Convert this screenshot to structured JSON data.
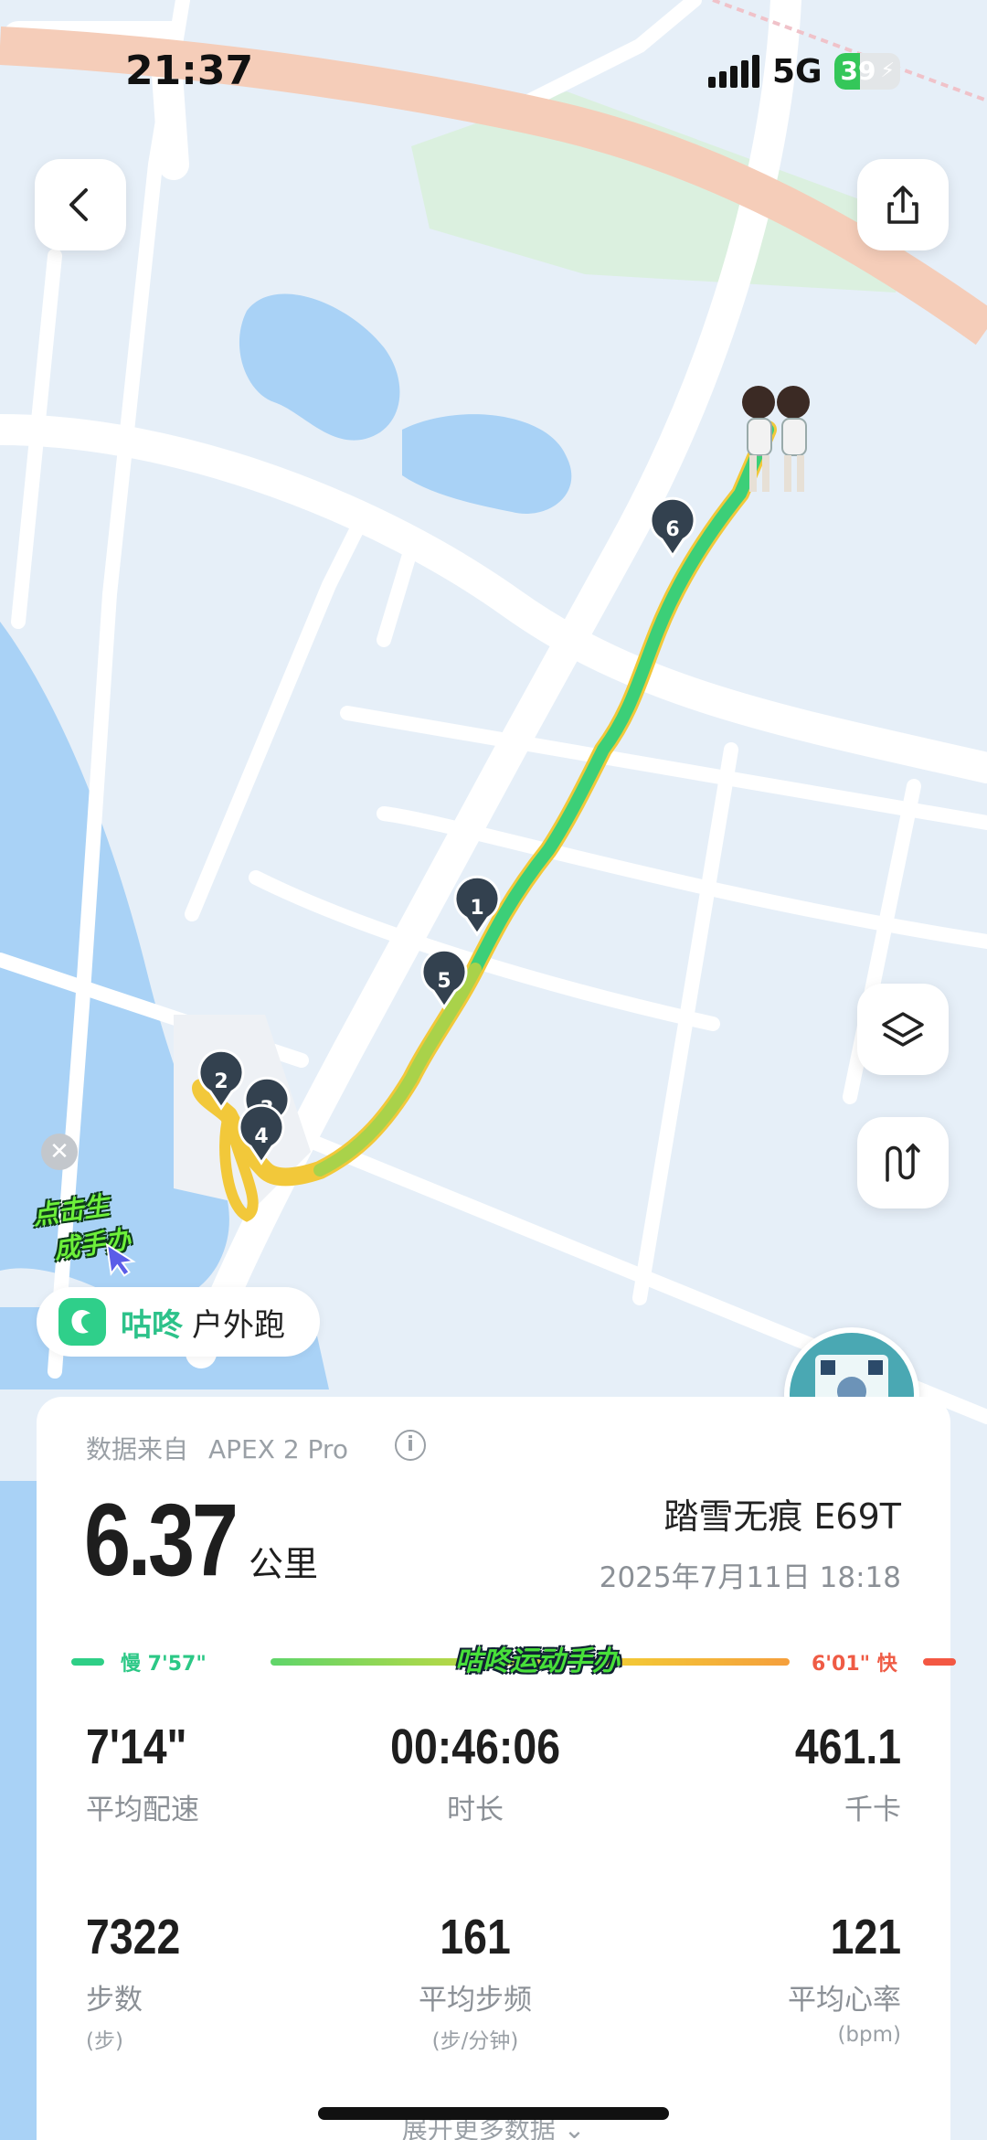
{
  "status_bar": {
    "time": "21:37",
    "network": "5G",
    "battery_level": "39",
    "battery_fraction": 0.39
  },
  "map": {
    "km_markers": [
      "1",
      "2",
      "3",
      "4",
      "5",
      "6"
    ],
    "route_colors": {
      "fast": "#2ecf7e",
      "mid": "#a9d24a",
      "slow": "#f2c83a"
    }
  },
  "sticker": {
    "line1": "点击生",
    "line2": "成手办"
  },
  "sport_pill": {
    "brand": "咕咚",
    "sport": "户外跑"
  },
  "card": {
    "source_label": "数据来自",
    "source_device": "APEX 2 Pro",
    "distance": "6.37",
    "distance_unit": "公里",
    "shoe": "踏雪无痕 E69T",
    "datetime": "2025年7月11日 18:18",
    "pace_range": {
      "slow_label": "慢 7'57\"",
      "fast_label": "6'01\" 快",
      "sticker_text": "咕咚运动手办"
    },
    "stats": [
      {
        "value": "7'14\"",
        "label": "平均配速",
        "sub": ""
      },
      {
        "value": "00:46:06",
        "label": "时长",
        "sub": ""
      },
      {
        "value": "461.1",
        "label": "千卡",
        "sub": ""
      },
      {
        "value": "7322",
        "label": "步数",
        "sub": "(步)"
      },
      {
        "value": "161",
        "label": "平均步频",
        "sub": "(步/分钟)"
      },
      {
        "value": "121",
        "label": "平均心率",
        "sub": "(bpm)"
      }
    ],
    "expand_label": "展开更多数据"
  },
  "icons": {
    "back": "chevron-left-icon",
    "share": "share-icon",
    "layers": "layers-icon",
    "route_mode": "route-icon",
    "close": "close-icon",
    "info": "info-icon"
  }
}
